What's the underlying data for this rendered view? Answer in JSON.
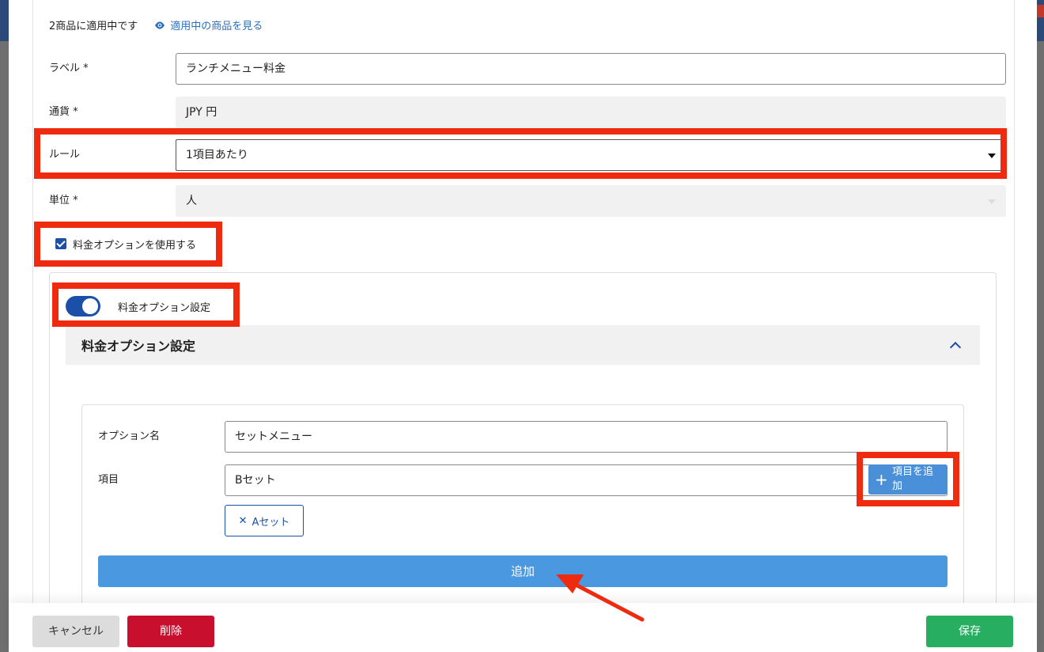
{
  "applied": {
    "count_text": "2商品に適用中です",
    "view_link": "適用中の商品を見る"
  },
  "form": {
    "label": {
      "label": "ラベル *",
      "value": "ランチメニュー料金"
    },
    "currency": {
      "label": "通貨 *",
      "value": "JPY 円"
    },
    "rule": {
      "label": "ルール",
      "value": "1項目あたり"
    },
    "unit": {
      "label": "単位 *",
      "value": "人"
    },
    "use_price_option": {
      "label": "料金オプションを使用する",
      "checked": true
    }
  },
  "price_option": {
    "toggle_label": "料金オプション設定",
    "toggle_on": true,
    "section_title": "料金オプション設定",
    "option_name": {
      "label": "オプション名",
      "value": "セットメニュー"
    },
    "items": {
      "label": "項目",
      "value": "Bセット",
      "add_button": "項目を追\n加"
    },
    "chips": [
      {
        "label": "Aセット",
        "remove_glyph": "✕"
      }
    ],
    "add_button": "追加"
  },
  "footer": {
    "cancel": "キャンセル",
    "delete": "削除",
    "save": "保存"
  },
  "colors": {
    "accent": "#1c4fa8",
    "highlight": "#ee2a0f",
    "add_button": "#4a98e0",
    "delete": "#c8102e",
    "save": "#27ae60"
  }
}
